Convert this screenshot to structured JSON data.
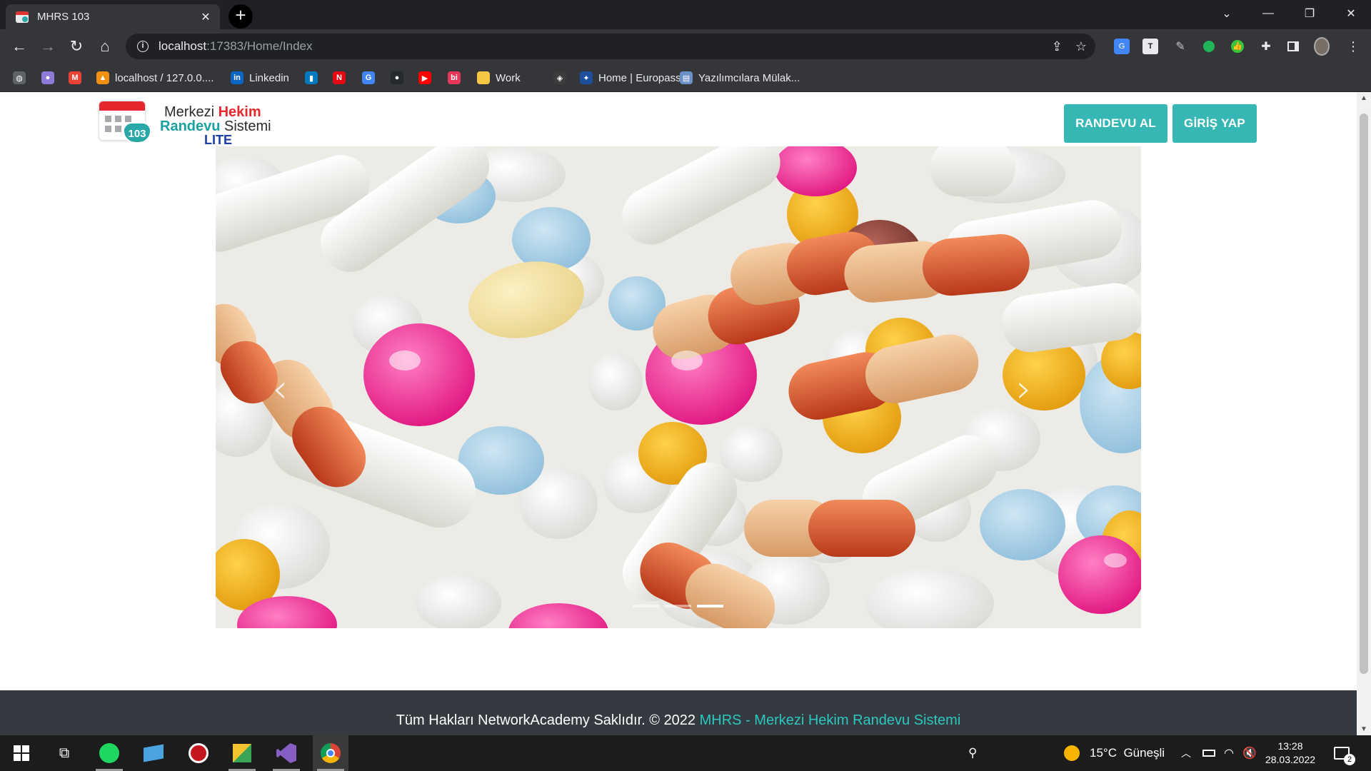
{
  "browser": {
    "tab_title": "MHRS 103",
    "tab_close": "✕",
    "new_tab": "+",
    "url_host": "localhost",
    "url_rest": ":17383/Home/Index",
    "window_controls": {
      "minimize": "—",
      "restore": "❐",
      "close": "✕",
      "tab_search": "⌄"
    }
  },
  "bookmarks": [
    {
      "label": "",
      "icon": "globe-icon",
      "color": "#5f6368"
    },
    {
      "label": "",
      "icon": "circle-icon",
      "color": "#8e7ad9"
    },
    {
      "label": "",
      "icon": "gmail-icon",
      "color": "#ea4335"
    },
    {
      "label": "localhost / 127.0.0....",
      "icon": "phpmyadmin-icon",
      "color": "#f29111"
    },
    {
      "label": "Linkedin",
      "icon": "linkedin-icon",
      "color": "#0a66c2"
    },
    {
      "label": "",
      "icon": "trello-icon",
      "color": "#0079bf"
    },
    {
      "label": "",
      "icon": "netflix-icon",
      "color": "#e50914"
    },
    {
      "label": "",
      "icon": "translate-icon",
      "color": "#4285f4"
    },
    {
      "label": "",
      "icon": "github-icon",
      "color": "#24292e"
    },
    {
      "label": "",
      "icon": "youtube-icon",
      "color": "#ff0000"
    },
    {
      "label": "",
      "icon": "bionluk-icon",
      "color": "#e6375a"
    },
    {
      "label": "Work",
      "icon": "folder-icon",
      "color": "#f6c744"
    },
    {
      "label": "",
      "icon": "codepen-icon",
      "color": "#3c3c3c"
    },
    {
      "label": "Home | Europass",
      "icon": "europass-icon",
      "color": "#1d4f9c"
    },
    {
      "label": "Yazılımcılara Mülak...",
      "icon": "document-icon",
      "color": "#6b8fc7"
    }
  ],
  "page": {
    "logo": {
      "line1_a": "Merkezi ",
      "line1_b": "Hekim",
      "line2_a": "Randevu",
      "line2_b": " Sistemi",
      "line3": "LITE",
      "badge": "103"
    },
    "buttons": {
      "appointment": "RANDEVU AL",
      "login": "GİRİŞ YAP"
    },
    "carousel": {
      "prev": "‹",
      "next": "›",
      "slide_count": 3,
      "active_slide": 3
    },
    "footer": {
      "text": "Tüm Hakları NetworkAcademy Saklıdır. © 2022 ",
      "link": "MHRS - Merkezi Hekim Randevu Sistemi"
    }
  },
  "taskbar": {
    "weather_temp": "15°C",
    "weather_text": "Güneşli",
    "time": "13:28",
    "date": "28.03.2022",
    "notifications": "2"
  },
  "colors": {
    "brand_teal": "#37b7b4",
    "footer_bg": "#343a40",
    "footer_link": "#2bc7c0",
    "logo_red": "#e5282d"
  }
}
